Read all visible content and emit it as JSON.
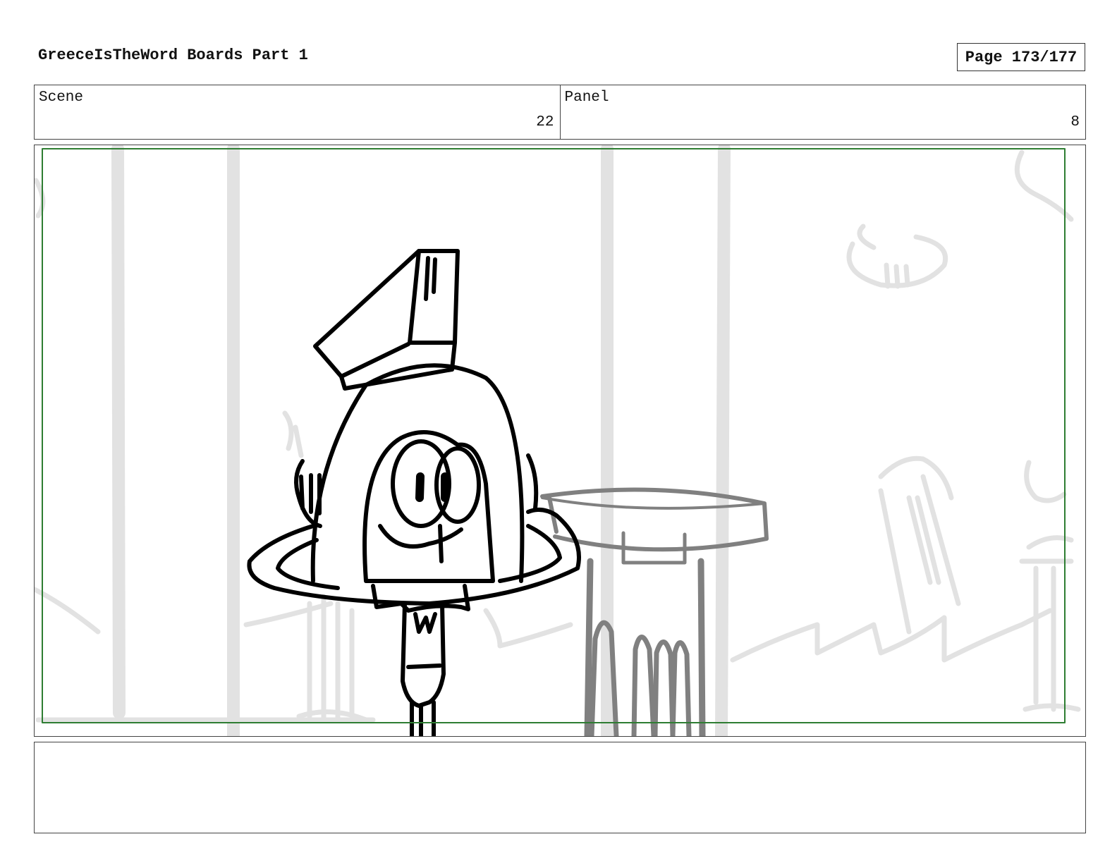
{
  "header": {
    "title": "GreeceIsTheWord Boards Part 1",
    "page_label": "Page 173/177"
  },
  "info": {
    "scene_label": "Scene",
    "scene_value": "22",
    "panel_label": "Panel",
    "panel_value": "8"
  },
  "notes": {
    "text": ""
  },
  "colors": {
    "safe_area_border": "#2e7d32",
    "background_sketch": "#e2e2e2",
    "midground_sketch": "#808080",
    "character_line": "#000000"
  }
}
